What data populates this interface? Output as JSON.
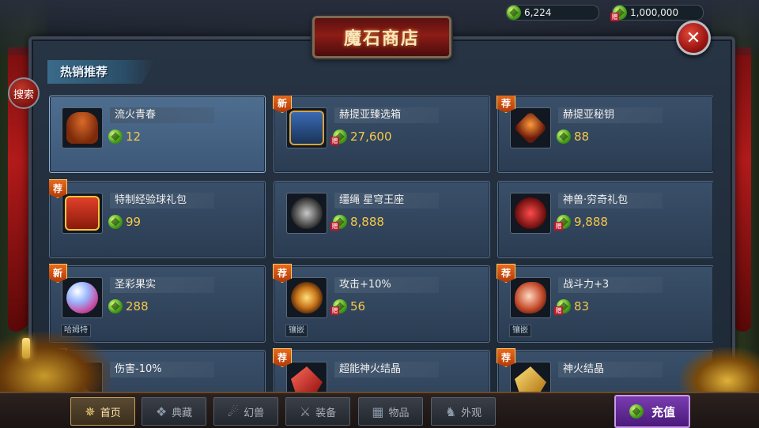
{
  "header": {
    "title": "魔石商店",
    "search_label": "搜索",
    "close_symbol": "✕"
  },
  "currency": [
    {
      "icon": "gem-icon",
      "value": "6,224"
    },
    {
      "icon": "bound-gem-icon",
      "value": "1,000,000"
    }
  ],
  "section": {
    "title": "热销推荐"
  },
  "items": [
    {
      "name": "流火青春",
      "price": "12",
      "currency": "gem",
      "tag": "",
      "sub": "",
      "icon": "hair-icon",
      "selected": true
    },
    {
      "name": "赫提亚臻选箱",
      "price": "27,600",
      "currency": "bound",
      "tag": "新",
      "sub": "",
      "icon": "chest-icon"
    },
    {
      "name": "赫提亚秘钥",
      "price": "88",
      "currency": "gem",
      "tag": "荐",
      "sub": "",
      "icon": "key-icon"
    },
    {
      "name": "特制经验球礼包",
      "price": "99",
      "currency": "gem",
      "tag": "荐",
      "sub": "",
      "icon": "gift-pack-icon"
    },
    {
      "name": "缰绳 星穹王座",
      "price": "8,888",
      "currency": "bound",
      "tag": "",
      "sub": "",
      "icon": "mount-icon"
    },
    {
      "name": "神兽·穷奇礼包",
      "price": "9,888",
      "currency": "bound",
      "tag": "",
      "sub": "",
      "icon": "beast-icon"
    },
    {
      "name": "圣彩果实",
      "price": "288",
      "currency": "gem",
      "tag": "新",
      "sub": "哈姆特",
      "icon": "fruit-icon"
    },
    {
      "name": "攻击+10%",
      "price": "56",
      "currency": "bound",
      "tag": "荐",
      "sub": "镶嵌",
      "icon": "swirl-icon"
    },
    {
      "name": "战斗力+3",
      "price": "83",
      "currency": "bound",
      "tag": "荐",
      "sub": "镶嵌",
      "icon": "stone-icon"
    },
    {
      "name": "伤害-10%",
      "price": "",
      "currency": "gem",
      "tag": "荐",
      "sub": "",
      "icon": "dagger-icon"
    },
    {
      "name": "超能神火结晶",
      "price": "",
      "currency": "gem",
      "tag": "荐",
      "sub": "",
      "icon": "red-crystal-icon"
    },
    {
      "name": "神火结晶",
      "price": "",
      "currency": "gem",
      "tag": "荐",
      "sub": "",
      "icon": "gold-crystal-icon"
    }
  ],
  "nav": [
    {
      "label": "首页",
      "icon": "compass-icon",
      "glyph": "✵",
      "active": true
    },
    {
      "label": "典藏",
      "icon": "collection-icon",
      "glyph": "❖"
    },
    {
      "label": "幻兽",
      "icon": "beast-nav-icon",
      "glyph": "☄"
    },
    {
      "label": "装备",
      "icon": "equipment-icon",
      "glyph": "⚔"
    },
    {
      "label": "物品",
      "icon": "items-icon",
      "glyph": "▦"
    },
    {
      "label": "外观",
      "icon": "appearance-icon",
      "glyph": "♞"
    }
  ],
  "recharge": {
    "label": "充值"
  }
}
